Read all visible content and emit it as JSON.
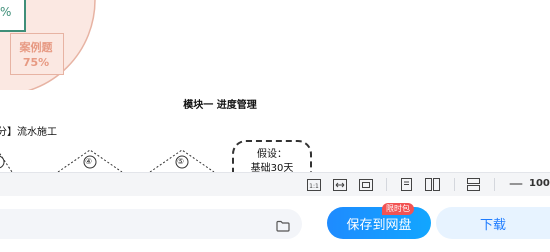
{
  "document": {
    "pie": {
      "partial_label": "%",
      "case_label": "案例题",
      "case_percent": "75%",
      "case_color": "#e79a83"
    },
    "heading": "模块一  进度管理",
    "subheading": "分】流水施工",
    "network_nodes": [
      "④",
      "⑤"
    ],
    "assumption": {
      "title": "假设：",
      "base": "基础30天"
    }
  },
  "toolbar": {
    "buttons": [
      {
        "name": "actual-size-icon"
      },
      {
        "name": "fit-width-icon"
      },
      {
        "name": "fit-page-icon"
      },
      {
        "name": "single-page-icon"
      },
      {
        "name": "two-page-icon"
      },
      {
        "name": "scroll-view-icon"
      }
    ],
    "zoom_minus": "—",
    "zoom_value": "100"
  },
  "actionbar": {
    "save_label": "保存到网盘",
    "badge": "限时包",
    "download_label": "下载",
    "accent_color": "#1e8bff"
  }
}
